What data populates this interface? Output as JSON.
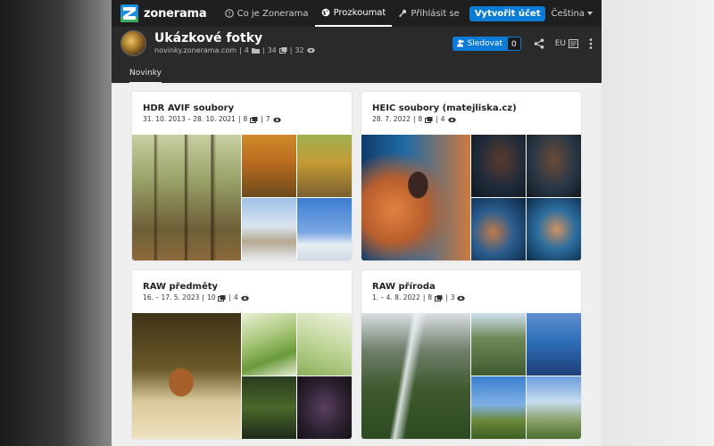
{
  "nav": {
    "brand": "zonerama",
    "items": [
      {
        "label": "Co je Zonerama",
        "icon": "help-icon"
      },
      {
        "label": "Prozkoumat",
        "icon": "globe-icon",
        "active": true
      },
      {
        "label": "Přihlásit se",
        "icon": "key-icon"
      }
    ],
    "create_account": "Vytvořit účet",
    "language": "Čeština"
  },
  "profile": {
    "title": "Ukázkové fotky",
    "domain": "novinky.zonerama.com",
    "albums": "4",
    "photos": "34",
    "views": "32",
    "follow_label": "Sledovat",
    "follow_count": "0",
    "lang_tag": "EU"
  },
  "tabs": [
    {
      "label": "Novinky",
      "active": true
    }
  ],
  "albums": [
    {
      "title": "HDR AVIF soubory",
      "dates": "31. 10. 2013 – 28. 10. 2021",
      "photos": "8",
      "views": "7"
    },
    {
      "title": "HEIC soubory (matejliska.cz)",
      "dates": "28. 7. 2022",
      "photos": "8",
      "views": "4"
    },
    {
      "title": "RAW předměty",
      "dates": "16. – 17. 5. 2023",
      "photos": "10",
      "views": "4"
    },
    {
      "title": "RAW příroda",
      "dates": "1. – 4. 8. 2022",
      "photos": "8",
      "views": "3"
    }
  ],
  "colors": {
    "nav_bg": "#1f1f1f",
    "profile_bg": "#2a2a2a",
    "accent": "#0a7bd6",
    "card_bg": "#ffffff",
    "page_bg": "#efefef"
  }
}
